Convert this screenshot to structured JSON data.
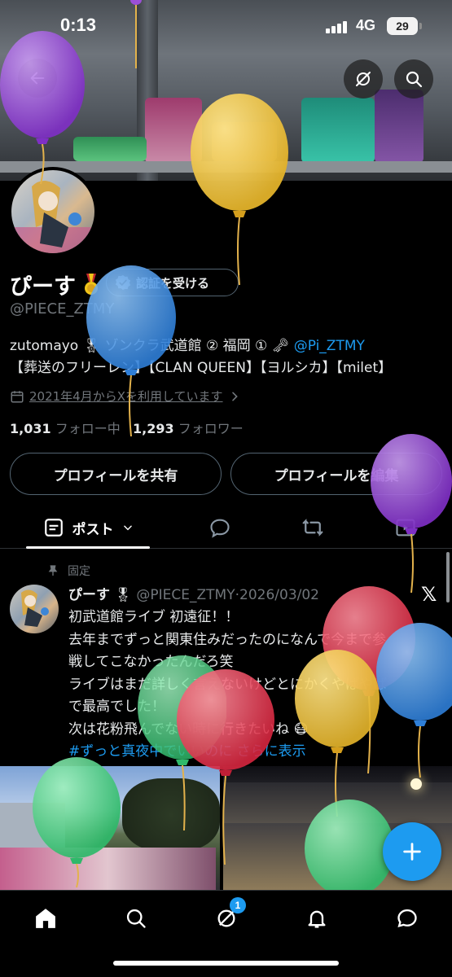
{
  "status_bar": {
    "time": "0:13",
    "network": "4G",
    "battery": "29"
  },
  "profile": {
    "display_name": "ぴーす",
    "verify_label": "認証を受ける",
    "handle": "@PIECE_ZTMY",
    "bio_line1_prefix": "zutomayo ",
    "bio_line1_text": " ゾンクラ武道館 ② 福岡 ①",
    "bio_line1_link": "@Pi_ZTMY",
    "bio_line2": "【葬送のフリーレン】【CLAN QUEEN】【ヨルシカ】【milet】",
    "joined": "2021年4月からXを利用しています",
    "following_count": "1,031",
    "following_label": "フォロー中",
    "followers_count": "1,293",
    "followers_label": "フォロワー"
  },
  "actions": {
    "share": "プロフィールを共有",
    "edit": "プロフィールを編集"
  },
  "tabs": {
    "posts_label": "ポスト"
  },
  "post": {
    "pinned_label": "固定",
    "author_name": "ぴーす",
    "author_handle": "@PIECE_ZTMY",
    "date": "2026/03/02",
    "line1": "初武道館ライブ 初遠征！！",
    "line2": "去年までずっと関東住みだったのになんで今まで参",
    "line3": "戦してこなかったんだろ笑",
    "line4": "ライブはまだ詳しく言えないけどとにかくやばやば",
    "line5": "で最高でした！",
    "line6": "次は花粉飛んでない時に行きたいね",
    "hashtag": "#ずっと真夜中でいいのに",
    "show_more": "さらに表示"
  },
  "bottom_nav": {
    "notification_badge": "1"
  },
  "colors": {
    "accent": "#1d9bf0",
    "background": "#000000",
    "muted": "#71767b"
  },
  "icons": [
    "back-arrow-icon",
    "hide-icon",
    "search-icon",
    "verified-icon",
    "calendar-icon",
    "chevron-right-icon",
    "pin-icon",
    "home-icon",
    "grok-icon",
    "bell-icon",
    "message-icon",
    "plus-icon",
    "reply-icon",
    "repost-icon",
    "media-icon"
  ]
}
